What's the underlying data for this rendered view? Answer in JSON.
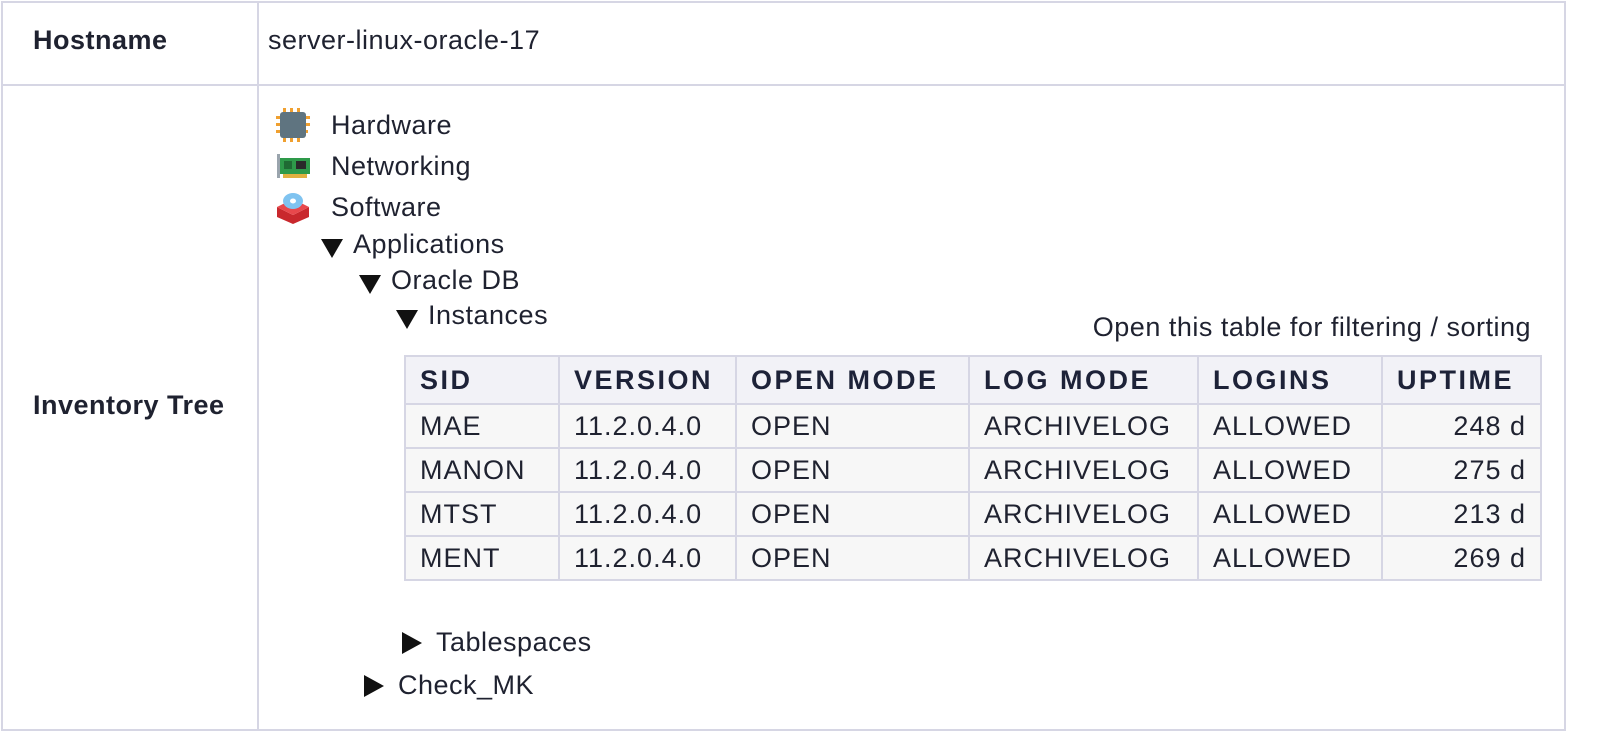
{
  "hostname": {
    "label": "Hostname",
    "value": "server-linux-oracle-17"
  },
  "inventory": {
    "label": "Inventory Tree",
    "nodes": {
      "hardware": {
        "label": "Hardware",
        "icon": "hardware-chip-icon"
      },
      "networking": {
        "label": "Networking",
        "icon": "network-card-icon"
      },
      "software": {
        "label": "Software",
        "icon": "software-package-icon"
      },
      "applications": {
        "label": "Applications",
        "expanded": true
      },
      "oracle_db": {
        "label": "Oracle DB",
        "expanded": true
      },
      "instances": {
        "label": "Instances",
        "expanded": true
      },
      "tablespaces": {
        "label": "Tablespaces",
        "expanded": false
      },
      "check_mk": {
        "label": "Check_MK",
        "expanded": false
      }
    },
    "open_table_link": "Open this table for filtering / sorting",
    "table": {
      "headers": [
        "SID",
        "VERSION",
        "OPEN MODE",
        "LOG MODE",
        "LOGINS",
        "UPTIME"
      ],
      "rows": [
        [
          "MAE",
          "11.2.0.4.0",
          "OPEN",
          "ARCHIVELOG",
          "ALLOWED",
          "248 d"
        ],
        [
          "MANON",
          "11.2.0.4.0",
          "OPEN",
          "ARCHIVELOG",
          "ALLOWED",
          "275 d"
        ],
        [
          "MTST",
          "11.2.0.4.0",
          "OPEN",
          "ARCHIVELOG",
          "ALLOWED",
          "213 d"
        ],
        [
          "MENT",
          "11.2.0.4.0",
          "OPEN",
          "ARCHIVELOG",
          "ALLOWED",
          "269 d"
        ]
      ]
    }
  },
  "colors": {
    "border": "#d6d6e4",
    "header_bg": "#f2f2f7",
    "cell_bg": "#f7f7f7",
    "text": "#1f2230"
  }
}
